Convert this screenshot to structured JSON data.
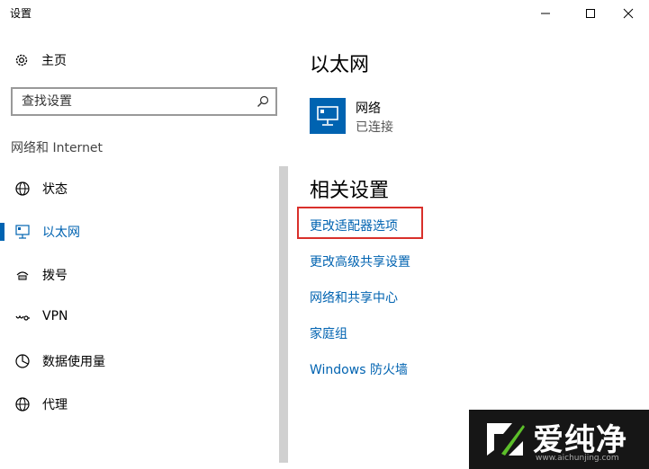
{
  "window": {
    "title": "设置"
  },
  "sidebar": {
    "home_label": "主页",
    "search_placeholder": "查找设置",
    "section": "网络和 Internet",
    "items": [
      {
        "label": "状态",
        "icon": "globe-icon",
        "active": false
      },
      {
        "label": "以太网",
        "icon": "ethernet-icon",
        "active": true
      },
      {
        "label": "拨号",
        "icon": "dialup-icon",
        "active": false
      },
      {
        "label": "VPN",
        "icon": "vpn-icon",
        "active": false
      },
      {
        "label": "数据使用量",
        "icon": "data-usage-icon",
        "active": false
      },
      {
        "label": "代理",
        "icon": "globe-icon",
        "active": false
      }
    ]
  },
  "main": {
    "title": "以太网",
    "network": {
      "name": "网络",
      "status": "已连接"
    },
    "related_title": "相关设置",
    "links": [
      "更改适配器选项",
      "更改高级共享设置",
      "网络和共享中心",
      "家庭组",
      "Windows 防火墙"
    ]
  },
  "watermark": {
    "text": "爱纯净",
    "url": "www.aichunjing.com"
  },
  "colors": {
    "accent": "#0063b1",
    "highlight": "#d9302b",
    "watermark_bg": "#161616"
  }
}
